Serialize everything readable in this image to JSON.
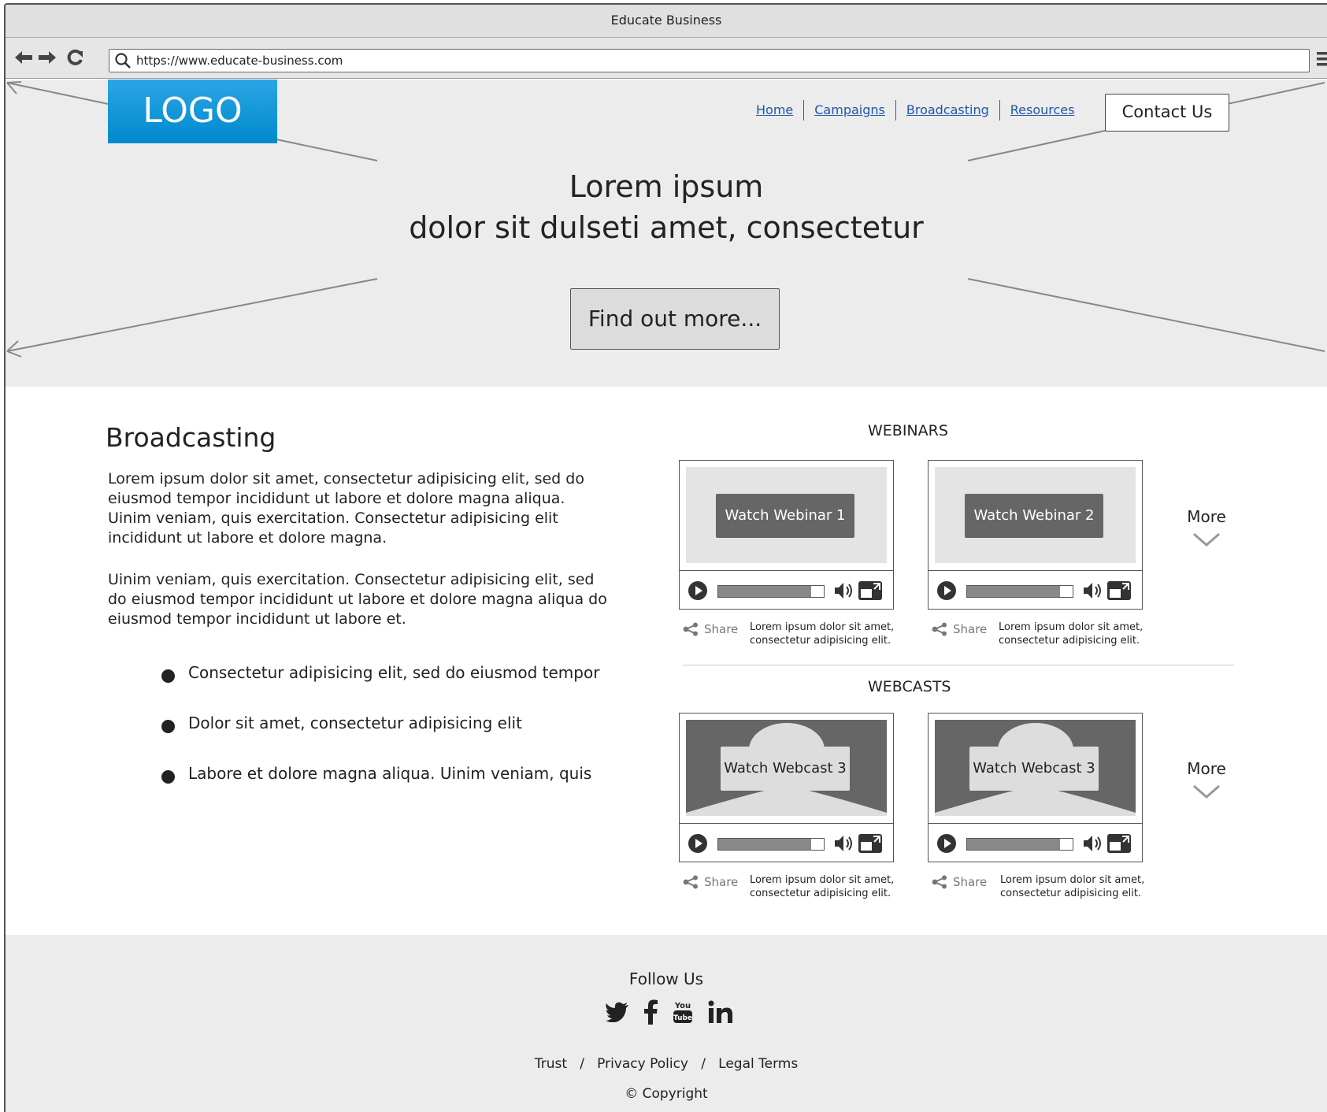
{
  "browser": {
    "title": "Educate Business",
    "url": "https://www.educate-business.com"
  },
  "header": {
    "logo": "LOGO",
    "nav": [
      "Home",
      "Campaigns",
      "Broadcasting",
      "Resources"
    ],
    "contact": "Contact Us"
  },
  "hero": {
    "line1": "Lorem ipsum",
    "line2": "dolor sit dulseti amet, consectetur",
    "button": "Find out more..."
  },
  "broadcasting": {
    "title": "Broadcasting",
    "para1": "Lorem ipsum dolor sit amet, consectetur adipisicing elit, sed do eiusmod tempor incididunt ut labore et dolore magna aliqua. Uinim veniam, quis exercitation. Consectetur adipisicing elit incididunt ut labore et dolore magna.",
    "para2": "Uinim veniam, quis exercitation. Consectetur adipisicing elit, sed do eiusmod tempor incididunt ut labore et dolore magna aliqua do eiusmod tempor incididunt ut labore et.",
    "bullets": [
      "Consectetur adipisicing elit, sed do eiusmod tempor",
      "Dolor sit amet, consectetur adipisicing elit",
      "Labore et dolore magna aliqua. Uinim veniam, quis"
    ]
  },
  "webinars": {
    "label": "WEBINARS",
    "more": "More",
    "items": [
      {
        "watch": "Watch Webinar 1",
        "share": "Share",
        "caption1": "Lorem ipsum dolor sit amet,",
        "caption2": "consectetur adipisicing elit."
      },
      {
        "watch": "Watch Webinar 2",
        "share": "Share",
        "caption1": "Lorem ipsum dolor sit amet,",
        "caption2": "consectetur adipisicing elit."
      }
    ]
  },
  "webcasts": {
    "label": "WEBCASTS",
    "more": "More",
    "items": [
      {
        "watch": "Watch Webcast 3",
        "share": "Share",
        "caption1": "Lorem ipsum dolor sit amet,",
        "caption2": "consectetur adipisicing elit."
      },
      {
        "watch": "Watch Webcast 3",
        "share": "Share",
        "caption1": "Lorem ipsum dolor sit amet,",
        "caption2": "consectetur adipisicing elit."
      }
    ]
  },
  "footer": {
    "follow": "Follow Us",
    "social_icons": [
      "twitter-icon",
      "facebook-icon",
      "youtube-icon",
      "linkedin-icon"
    ],
    "links": [
      "Trust",
      "Privacy Policy",
      "Legal Terms"
    ],
    "copyright": "Copyright"
  },
  "colors": {
    "logo": "#0089cc",
    "link": "#1f56a6",
    "hero_bg": "#ececec"
  }
}
